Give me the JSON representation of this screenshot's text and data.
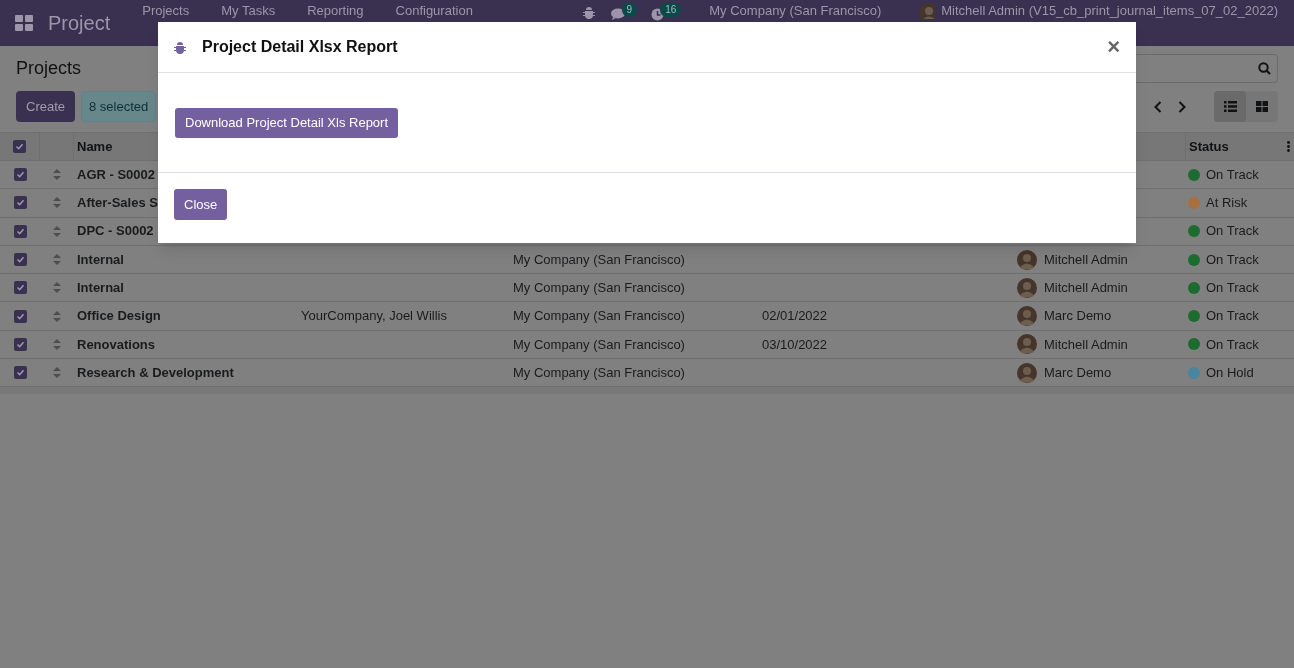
{
  "navbar": {
    "app_name": "Project",
    "menu": [
      "Projects",
      "My Tasks",
      "Reporting",
      "Configuration"
    ],
    "messages_badge": "9",
    "activities_badge": "16",
    "company": "My Company (San Francisco)",
    "user": "Mitchell Admin (V15_cb_print_journal_items_07_02_2022)"
  },
  "control_panel": {
    "title": "Projects",
    "create_button": "Create",
    "selection_badge": "8 selected",
    "views": [
      {
        "kind": "list",
        "selected": true
      },
      {
        "kind": "kanban",
        "selected": false
      }
    ]
  },
  "table": {
    "columns": [
      "Name",
      "Status"
    ],
    "all_checked": true,
    "rows": [
      {
        "checked": true,
        "name": "AGR - S0002",
        "column_2": "",
        "company": "",
        "date": "",
        "manager": "",
        "status": "On Track",
        "color": "#1c6b2f"
      },
      {
        "checked": true,
        "name": "After-Sales S",
        "column_2": "",
        "company": "",
        "date": "",
        "manager": "",
        "status": "At Risk",
        "color": "#a8703f"
      },
      {
        "checked": true,
        "name": "DPC - S0002",
        "column_2": "",
        "company": "",
        "date": "",
        "manager": "",
        "status": "On Track",
        "color": "#1c6b2f"
      },
      {
        "checked": true,
        "name": "Internal",
        "column_2": "",
        "company": "My Company (San Francisco)",
        "date": "",
        "manager": "Mitchell Admin",
        "status": "On Track",
        "color": "#1c6b2f"
      },
      {
        "checked": true,
        "name": "Internal",
        "column_2": "",
        "company": "My Company (San Francisco)",
        "date": "",
        "manager": "Mitchell Admin",
        "status": "On Track",
        "color": "#1c6b2f"
      },
      {
        "checked": true,
        "name": "Office Design",
        "column_2": "YourCompany, Joel Willis",
        "company": "My Company (San Francisco)",
        "date": "02/01/2022",
        "manager": "Marc Demo",
        "status": "On Track",
        "color": "#1c6b2f"
      },
      {
        "checked": true,
        "name": "Renovations",
        "column_2": "",
        "company": "My Company (San Francisco)",
        "date": "03/10/2022",
        "manager": "Mitchell Admin",
        "status": "On Track",
        "color": "#1c6b2f"
      },
      {
        "checked": true,
        "name": "Research & Development",
        "column_2": "",
        "company": "My Company (San Francisco)",
        "date": "",
        "manager": "Marc Demo",
        "status": "On Hold",
        "color": "#4a86a0"
      }
    ]
  },
  "dialog": {
    "title": "Project Detail Xlsx Report",
    "close_symbol": "×",
    "download_button": "Download Project Detail Xls Report",
    "close_button": "Close"
  }
}
